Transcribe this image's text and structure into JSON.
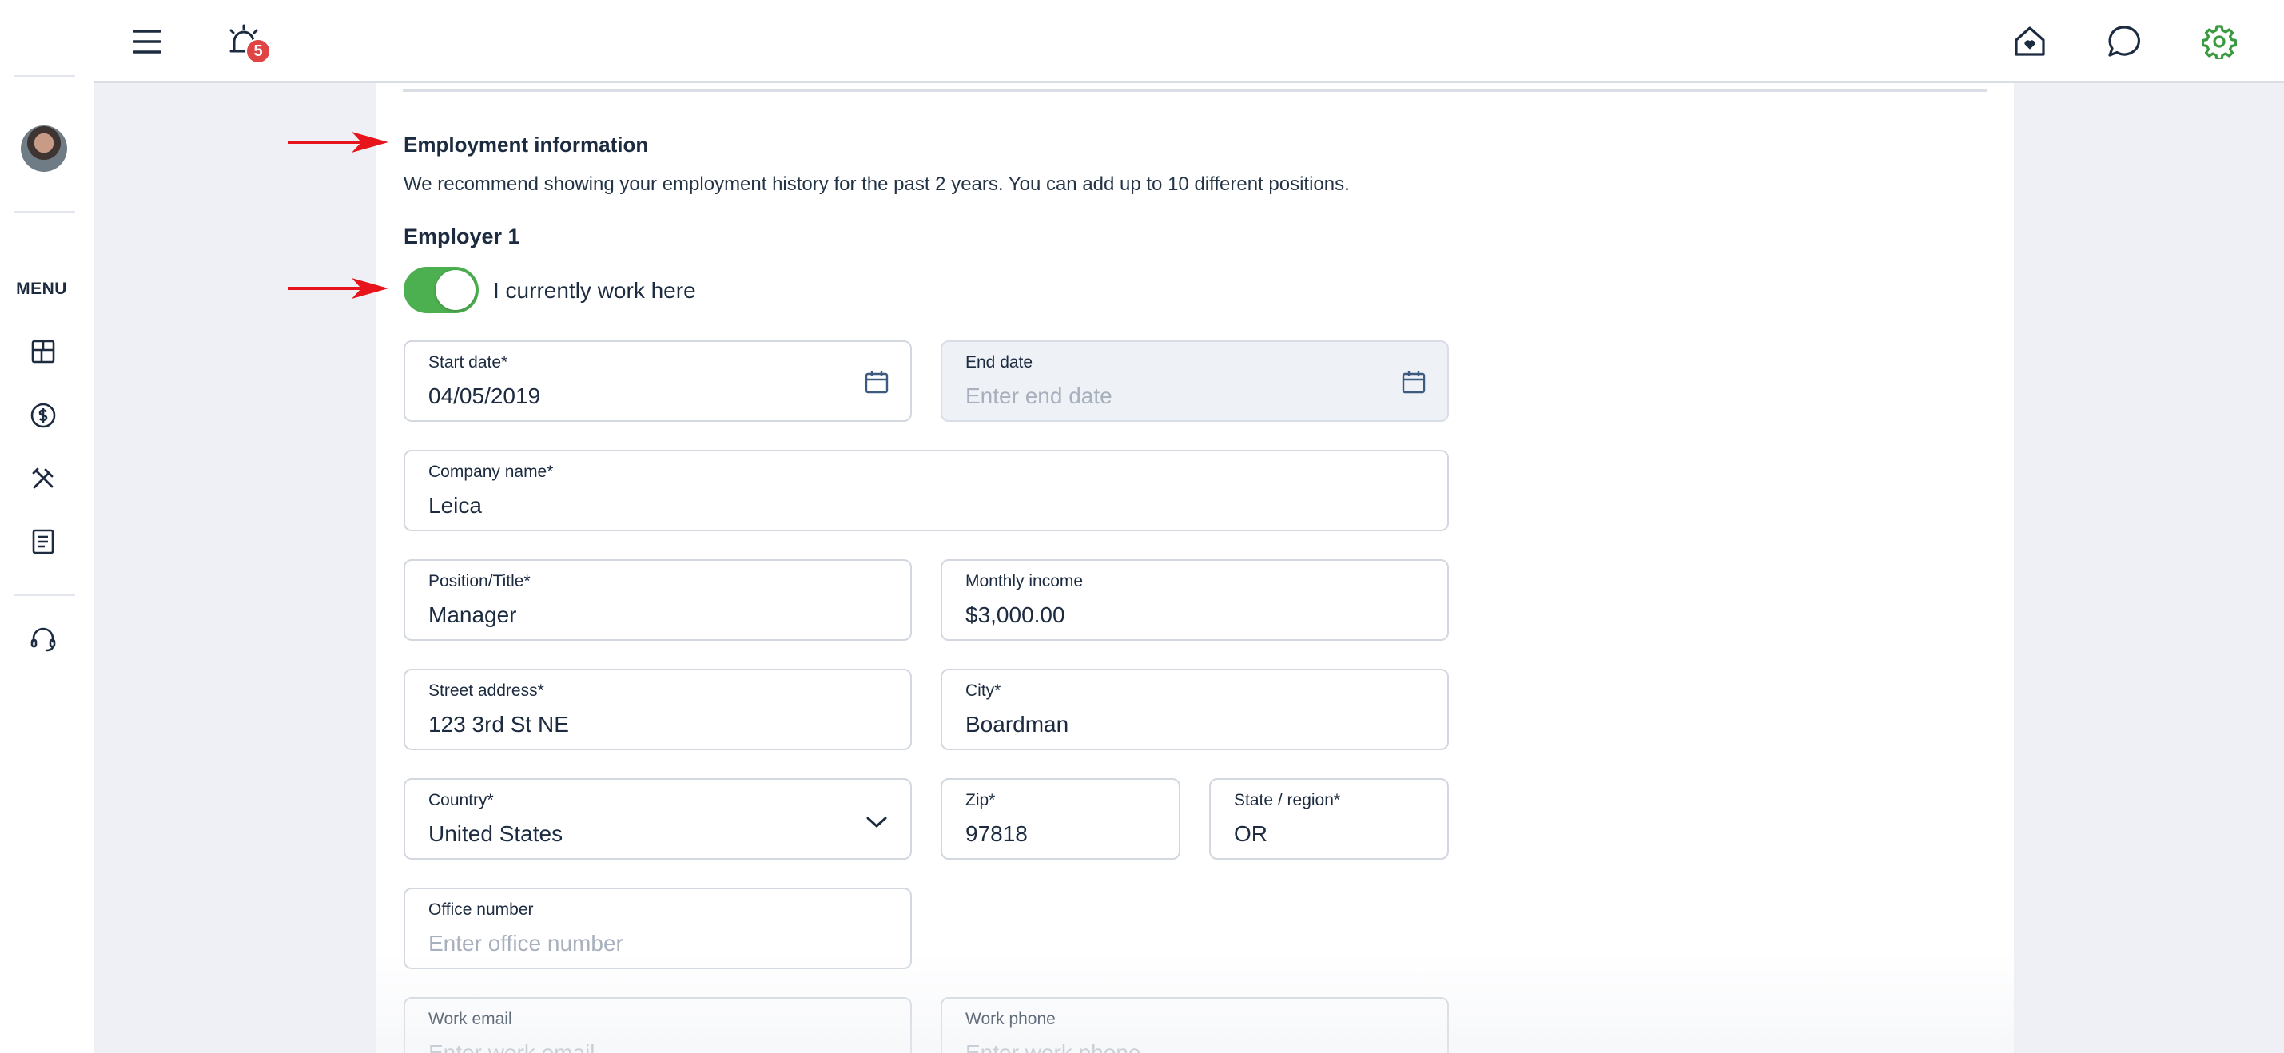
{
  "header": {
    "notification_count": "5",
    "icons": [
      "hamburger-menu-icon",
      "alarm-icon",
      "home-heart-icon",
      "chat-bubble-icon",
      "settings-gear-icon"
    ],
    "accent_color": "#3a9a3f"
  },
  "sidebar": {
    "menu_label": "MENU",
    "items": [
      {
        "icon": "dashboard-icon"
      },
      {
        "icon": "dollar-circle-icon"
      },
      {
        "icon": "tools-icon"
      },
      {
        "icon": "document-icon"
      },
      {
        "icon": "headset-support-icon"
      }
    ]
  },
  "form": {
    "section_title": "Employment information",
    "section_description": "We recommend showing your employment history for the past 2 years. You can add up to 10 different positions.",
    "employer_title": "Employer 1",
    "currently_work_here": {
      "label": "I currently work here",
      "on": true,
      "color": "#4caf50"
    },
    "fields": {
      "start_date": {
        "label": "Start date*",
        "value": "04/05/2019"
      },
      "end_date": {
        "label": "End date",
        "placeholder": "Enter end date",
        "disabled": true
      },
      "company_name": {
        "label": "Company name*",
        "value": "Leica"
      },
      "position_title": {
        "label": "Position/Title*",
        "value": "Manager"
      },
      "monthly_income": {
        "label": "Monthly income",
        "value": "$3,000.00"
      },
      "street_address": {
        "label": "Street address*",
        "value": "123 3rd St NE"
      },
      "city": {
        "label": "City*",
        "value": "Boardman"
      },
      "country": {
        "label": "Country*",
        "value": "United States"
      },
      "zip": {
        "label": "Zip*",
        "value": "97818"
      },
      "state_region": {
        "label": "State / region*",
        "value": "OR"
      },
      "office_number": {
        "label": "Office number",
        "placeholder": "Enter office number"
      },
      "work_email": {
        "label": "Work email",
        "placeholder": "Enter work email"
      },
      "work_phone": {
        "label": "Work phone",
        "placeholder": "Enter work phone"
      }
    }
  },
  "annotations": {
    "arrow_color": "#e8141b"
  }
}
